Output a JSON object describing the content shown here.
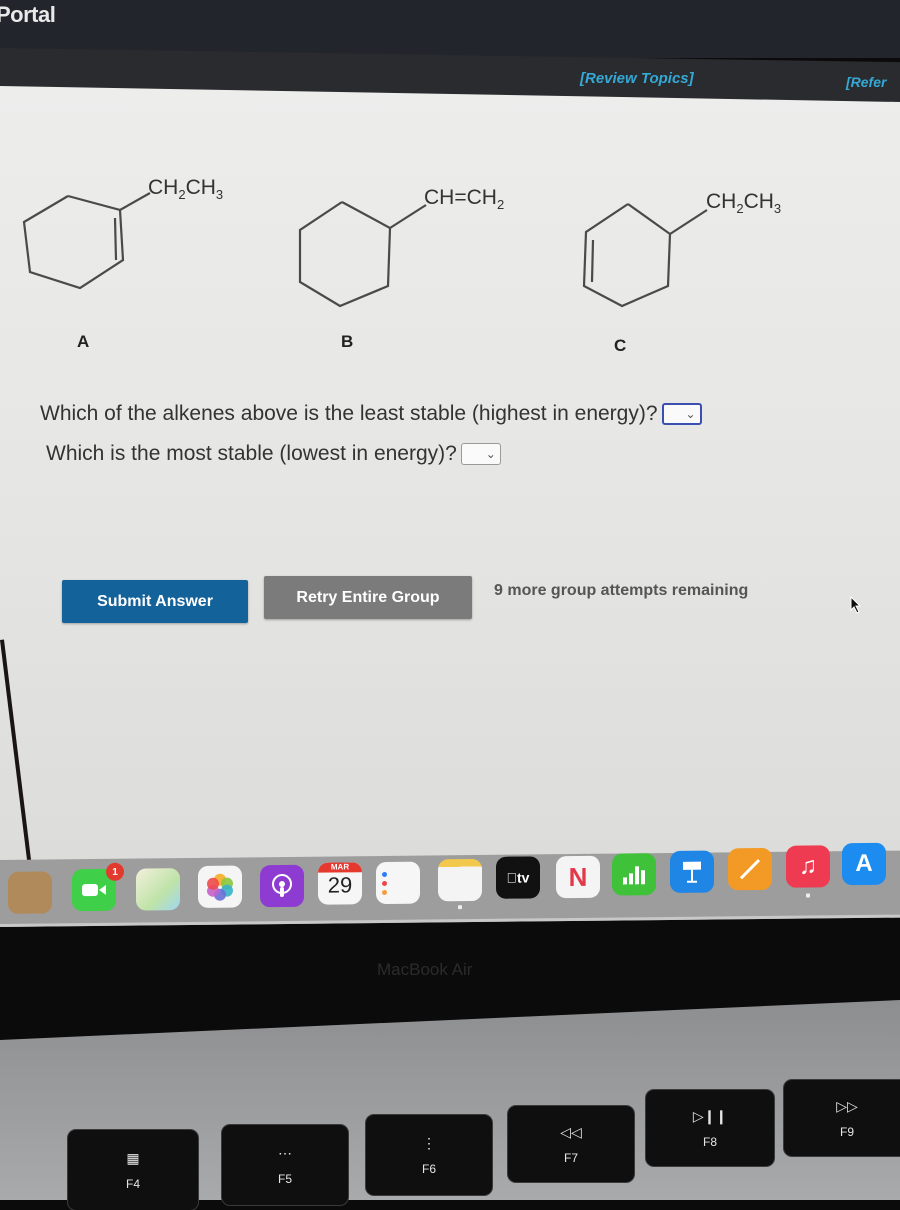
{
  "window": {
    "title": "Portal"
  },
  "header": {
    "review_topics": "[Review Topics]",
    "references": "[Refer"
  },
  "molecules": [
    {
      "label": "A",
      "substituent": {
        "main": "CH",
        "sub1": "2",
        "main2": "CH",
        "sub2": "3"
      },
      "description": "1-ethylcyclohexene"
    },
    {
      "label": "B",
      "substituent": {
        "main": "CH=CH",
        "sub1": "2"
      },
      "description": "vinylcyclohexane"
    },
    {
      "label": "C",
      "substituent": {
        "main": "CH",
        "sub1": "2",
        "main2": "CH",
        "sub2": "3"
      },
      "description": "4-ethylcyclohexene"
    }
  ],
  "questions": [
    {
      "text": "Which of the alkenes above is the least stable (highest in energy)?",
      "selected": "",
      "focused": true
    },
    {
      "text": "Which is the most stable (lowest in energy)?",
      "selected": "",
      "focused": false
    }
  ],
  "actions": {
    "submit_label": "Submit Answer",
    "retry_label": "Retry Entire Group",
    "attempts_text": "9 more group attempts remaining"
  },
  "dock": {
    "facetime_badge": "1",
    "calendar_month": "MAR",
    "calendar_day": "29",
    "tv_label": "tv",
    "apps": [
      "Contacts",
      "FaceTime",
      "Maps",
      "Photos",
      "Podcasts",
      "Calendar",
      "Reminders",
      "Notes",
      "TV",
      "News",
      "Numbers",
      "Keynote",
      "Pages",
      "Music",
      "App Store"
    ]
  },
  "device": {
    "brand": "MacBook Air",
    "keys": [
      {
        "label": "F4",
        "glyph": "launchpad"
      },
      {
        "label": "F5",
        "glyph": "keyboard-brightness-down"
      },
      {
        "label": "F6",
        "glyph": "keyboard-brightness-up"
      },
      {
        "label": "F7",
        "glyph": "rewind"
      },
      {
        "label": "F8",
        "glyph": "play-pause"
      },
      {
        "label": "F9",
        "glyph": "fast-forward"
      }
    ]
  },
  "colors": {
    "link": "#35a9d6",
    "submit": "#13629a",
    "retry": "#7b7b7b",
    "focus_border": "#3b4fb0"
  }
}
